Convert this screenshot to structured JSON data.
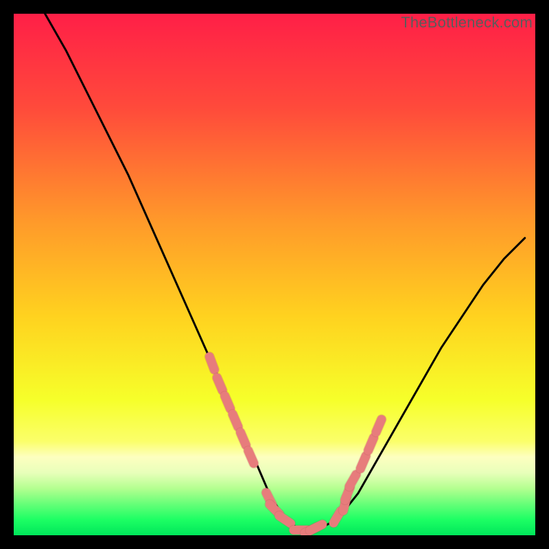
{
  "watermark": "TheBottleneck.com",
  "colors": {
    "bg": "#000000",
    "curve": "#000000",
    "marker_fill": "#e77c7c",
    "marker_stroke": "#b85a5a",
    "grad_top": "#ff1f47",
    "grad_mid_upper": "#ff7a2e",
    "grad_mid": "#ffd21f",
    "grad_mid_lower": "#f6ff2a",
    "grad_band_pale": "#fbffb0",
    "grad_green_light": "#8cff7a",
    "grad_green": "#00e65a"
  },
  "chart_data": {
    "type": "line",
    "title": "",
    "xlabel": "",
    "ylabel": "",
    "xlim": [
      0,
      100
    ],
    "ylim": [
      0,
      100
    ],
    "curve": {
      "x": [
        6,
        10,
        14,
        18,
        22,
        26,
        30,
        34,
        38,
        42,
        46,
        49,
        52,
        55,
        58,
        62,
        66,
        70,
        74,
        78,
        82,
        86,
        90,
        94,
        98
      ],
      "y": [
        100,
        93,
        85,
        77,
        69,
        60,
        51,
        42,
        33,
        24,
        15,
        8,
        3,
        1,
        1,
        3,
        8,
        15,
        22,
        29,
        36,
        42,
        48,
        53,
        57
      ]
    },
    "markers": {
      "x": [
        38,
        39.5,
        41,
        42.5,
        44,
        45.5,
        49,
        50,
        52,
        55,
        57,
        58,
        62,
        63.5,
        64,
        65,
        67,
        68.5,
        70
      ],
      "y": [
        33,
        29,
        25.5,
        22,
        18.5,
        15,
        7,
        5,
        3,
        1,
        1,
        1.5,
        3.5,
        6,
        8,
        10.5,
        14,
        17.5,
        21
      ]
    }
  }
}
